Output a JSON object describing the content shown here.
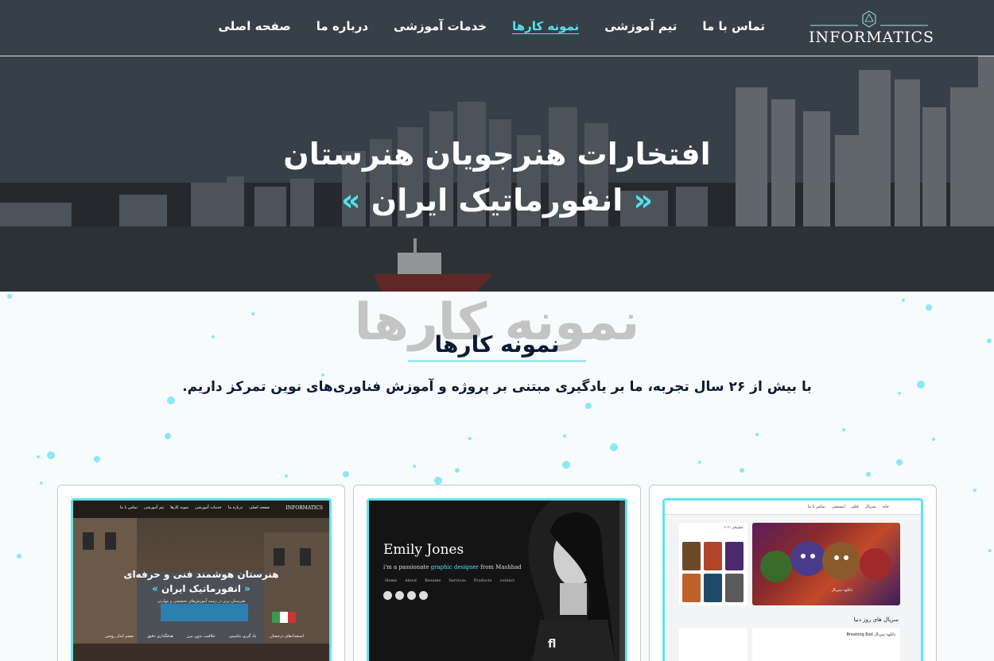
{
  "nav": {
    "logo_text": "INFORMATICS",
    "items": [
      {
        "label": "صفحه اصلی"
      },
      {
        "label": "درباره ما"
      },
      {
        "label": "خدمات آموزشی"
      },
      {
        "label": "نمونه کارها",
        "active": true
      },
      {
        "label": "تیم آموزشی"
      },
      {
        "label": "تماس با ما"
      }
    ]
  },
  "hero": {
    "line1": "افتخارات هنرجویان هنرستان",
    "line2": "انفورماتیک ایران",
    "quote_open": "«",
    "quote_close": "»"
  },
  "section": {
    "ghost_title": "نمونه کارها",
    "title": "نمونه کارها",
    "subtitle": "با بیش از ۲۶ سال تجربه، ما بر یادگیری مبتنی بر پروژه و آموزش فناوری‌های نوین تمرکز داریم."
  },
  "cards": {
    "school": {
      "brand": "INFORMATICS",
      "links": [
        "صفحه اصلی",
        "درباره ما",
        "خدمات آموزشی",
        "نمونه کارها",
        "تیم آموزشی",
        "تماس با ما"
      ],
      "title1": "هنرستان هوشمند فنی و حرفه‌ای",
      "title2": "انفورماتیک ایران",
      "small": "هنرستان برتر در زمینه آموزش‌های تخصصی و مهارتی",
      "features": [
        "استعدادهای درخشان",
        "یاد گیری ماشینی",
        "خلاقیت بدون مرز",
        "هدفگذاری دقیق",
        "چشم انداز روشن"
      ]
    },
    "portfolio": {
      "name": "Emily Jones",
      "tag_pre": "i'm a passionate",
      "tag_em": "graphic designer",
      "tag_post": "from Mashhad",
      "links": [
        "Home",
        "About",
        "Resume",
        "Services",
        "Products",
        "contact"
      ]
    },
    "movies": {
      "nav_links": [
        "خانه",
        "سریال",
        "فیلم",
        "انیمیشن",
        "تماس با ما"
      ],
      "side_head": "فیلم‌های ۲۰۲۱",
      "hero_caption": "دانلود سریال",
      "section_title": "سریال های روز دنیا",
      "box_title": "دانلود سریال Breaking Bad"
    }
  },
  "colors": {
    "accent": "#4fe3ee",
    "heading": "#0c1b33",
    "ghost": "#c4c4c4",
    "dot": "#7fe6f7"
  }
}
